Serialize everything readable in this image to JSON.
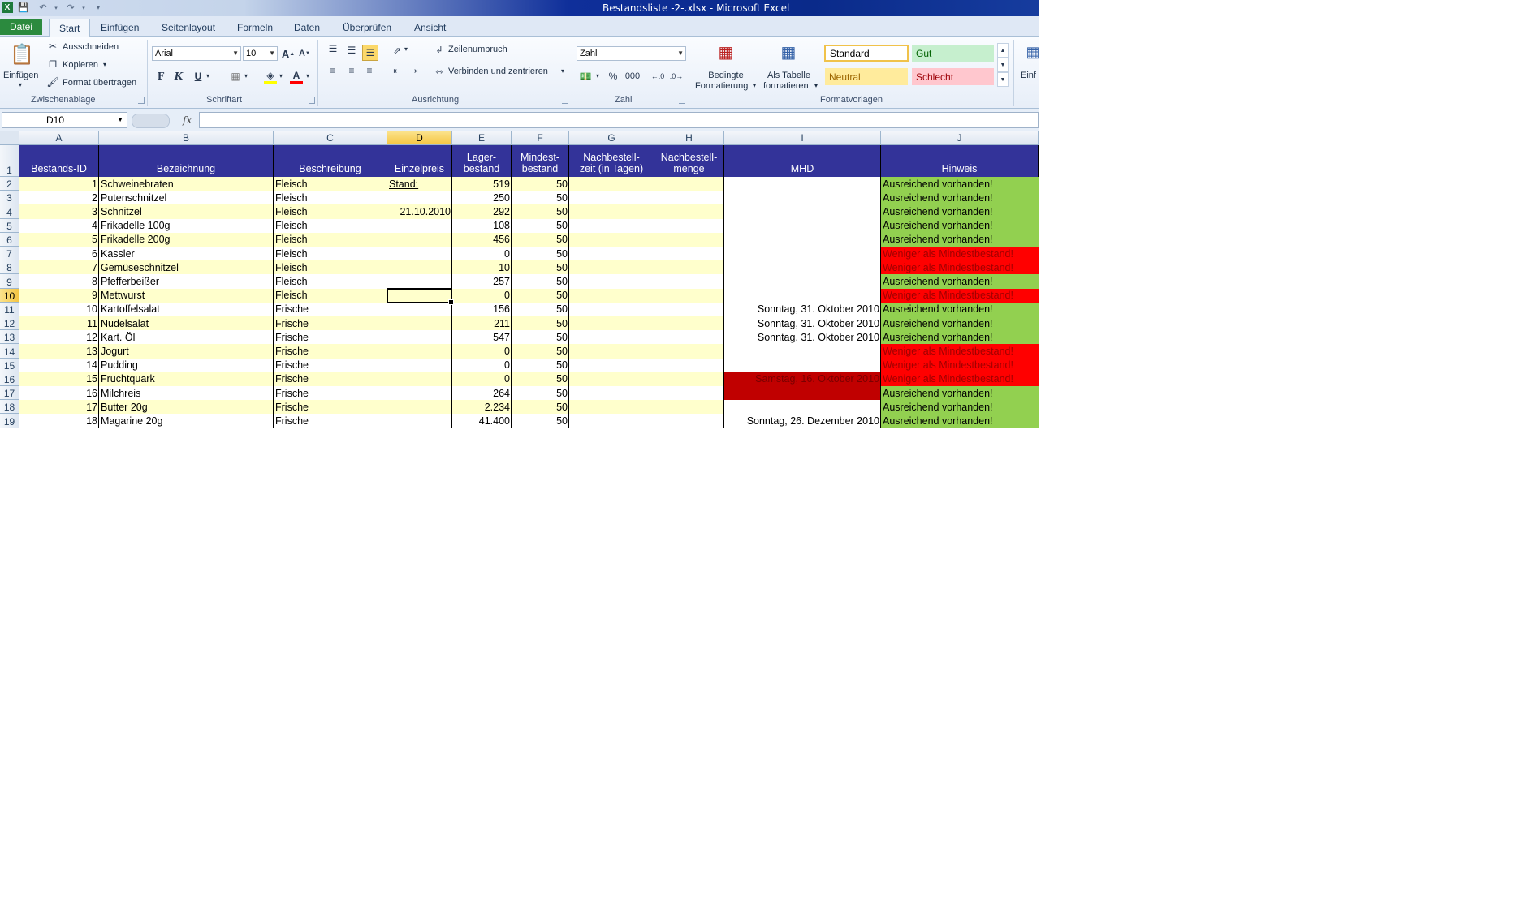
{
  "window": {
    "title": "Bestandsliste -2-.xlsx - Microsoft Excel",
    "app_icon": "excel-icon",
    "qat": [
      "save-icon",
      "undo-icon",
      "redo-icon",
      "customize-icon"
    ]
  },
  "tabs": {
    "file": "Datei",
    "items": [
      "Start",
      "Einfügen",
      "Seitenlayout",
      "Formeln",
      "Daten",
      "Überprüfen",
      "Ansicht"
    ],
    "active": "Start"
  },
  "ribbon": {
    "clipboard": {
      "paste": "Einfügen",
      "cut": "Ausschneiden",
      "copy": "Kopieren",
      "format_painter": "Format übertragen",
      "label": "Zwischenablage"
    },
    "font": {
      "name": "Arial",
      "size": "10",
      "bold": "F",
      "italic": "K",
      "underline": "U",
      "label": "Schriftart"
    },
    "alignment": {
      "wrap": "Zeilenumbruch",
      "merge": "Verbinden und zentrieren",
      "label": "Ausrichtung"
    },
    "number": {
      "format": "Zahl",
      "percent": "%",
      "thousands": "000",
      "label": "Zahl"
    },
    "styles": {
      "conditional": [
        "Bedingte",
        "Formatierung"
      ],
      "as_table": [
        "Als Tabelle",
        "formatieren"
      ],
      "standard": "Standard",
      "gut": "Gut",
      "neutral": "Neutral",
      "schlecht": "Schlecht",
      "label": "Formatvorlagen"
    },
    "cells": {
      "insert": "Einf"
    }
  },
  "formula_bar": {
    "name_box": "D10",
    "fx": "fx",
    "content": ""
  },
  "sheet": {
    "columns": [
      "A",
      "B",
      "C",
      "D",
      "E",
      "F",
      "G",
      "H",
      "I",
      "J"
    ],
    "selected_column": "D",
    "selected_row": "10",
    "headers": {
      "A": "Bestands-ID",
      "B": "Bezeichnung",
      "C": "Beschreibung",
      "D": "Einzelpreis",
      "E": [
        "Lager-",
        "bestand"
      ],
      "F": [
        "Mindest-",
        "bestand"
      ],
      "G": [
        "Nachbestell-",
        "zeit (in Tagen)"
      ],
      "H": [
        "Nachbestell-",
        "menge"
      ],
      "I": "MHD",
      "J": "Hinweis"
    },
    "rows": [
      {
        "n": "2",
        "id": "1",
        "name": "Schweinebraten",
        "desc": "Fleisch",
        "price": "Stand:",
        "stock": "519",
        "min": "50",
        "mhd": "",
        "hint": "Ausreichend vorhanden!",
        "status": "ok"
      },
      {
        "n": "3",
        "id": "2",
        "name": "Putenschnitzel",
        "desc": "Fleisch",
        "price": "",
        "stock": "250",
        "min": "50",
        "mhd": "",
        "hint": "Ausreichend vorhanden!",
        "status": "ok"
      },
      {
        "n": "4",
        "id": "3",
        "name": "Schnitzel",
        "desc": "Fleisch",
        "price": "21.10.2010",
        "stock": "292",
        "min": "50",
        "mhd": "",
        "hint": "Ausreichend vorhanden!",
        "status": "ok"
      },
      {
        "n": "5",
        "id": "4",
        "name": "Frikadelle 100g",
        "desc": "Fleisch",
        "price": "",
        "stock": "108",
        "min": "50",
        "mhd": "",
        "hint": "Ausreichend vorhanden!",
        "status": "ok"
      },
      {
        "n": "6",
        "id": "5",
        "name": "Frikadelle 200g",
        "desc": "Fleisch",
        "price": "",
        "stock": "456",
        "min": "50",
        "mhd": "",
        "hint": "Ausreichend vorhanden!",
        "status": "ok"
      },
      {
        "n": "7",
        "id": "6",
        "name": "Kassler",
        "desc": "Fleisch",
        "price": "",
        "stock": "0",
        "min": "50",
        "mhd": "",
        "hint": "Weniger als Mindestbestand!",
        "status": "low"
      },
      {
        "n": "8",
        "id": "7",
        "name": "Gemüseschnitzel",
        "desc": "Fleisch",
        "price": "",
        "stock": "10",
        "min": "50",
        "mhd": "",
        "hint": "Weniger als Mindestbestand!",
        "status": "low"
      },
      {
        "n": "9",
        "id": "8",
        "name": "Pfefferbeißer",
        "desc": "Fleisch",
        "price": "",
        "stock": "257",
        "min": "50",
        "mhd": "",
        "hint": "Ausreichend vorhanden!",
        "status": "ok"
      },
      {
        "n": "10",
        "id": "9",
        "name": "Mettwurst",
        "desc": "Fleisch",
        "price": "",
        "stock": "0",
        "min": "50",
        "mhd": "",
        "hint": "Weniger als Mindestbestand!",
        "status": "low"
      },
      {
        "n": "11",
        "id": "10",
        "name": "Kartoffelsalat",
        "desc": "Frische",
        "price": "",
        "stock": "156",
        "min": "50",
        "mhd": "Sonntag, 31. Oktober 2010",
        "hint": "Ausreichend vorhanden!",
        "status": "ok"
      },
      {
        "n": "12",
        "id": "11",
        "name": "Nudelsalat",
        "desc": "Frische",
        "price": "",
        "stock": "211",
        "min": "50",
        "mhd": "Sonntag, 31. Oktober 2010",
        "hint": "Ausreichend vorhanden!",
        "status": "ok"
      },
      {
        "n": "13",
        "id": "12",
        "name": "Kart. Öl",
        "desc": "Frische",
        "price": "",
        "stock": "547",
        "min": "50",
        "mhd": "Sonntag, 31. Oktober 2010",
        "hint": "Ausreichend vorhanden!",
        "status": "ok"
      },
      {
        "n": "14",
        "id": "13",
        "name": "Jogurt",
        "desc": "Frische",
        "price": "",
        "stock": "0",
        "min": "50",
        "mhd": "",
        "hint": "Weniger als Mindestbestand!",
        "status": "low"
      },
      {
        "n": "15",
        "id": "14",
        "name": "Pudding",
        "desc": "Frische",
        "price": "",
        "stock": "0",
        "min": "50",
        "mhd": "",
        "hint": "Weniger als Mindestbestand!",
        "status": "low"
      },
      {
        "n": "16",
        "id": "15",
        "name": "Fruchtquark",
        "desc": "Frische",
        "price": "",
        "stock": "0",
        "min": "50",
        "mhd": "Samstag, 16. Oktober 2010",
        "hint": "Weniger als Mindestbestand!",
        "status": "low",
        "mhd_expired": true
      },
      {
        "n": "17",
        "id": "16",
        "name": "Milchreis",
        "desc": "Frische",
        "price": "",
        "stock": "264",
        "min": "50",
        "mhd": "",
        "hint": "Ausreichend vorhanden!",
        "status": "ok",
        "mhd_expired": true
      },
      {
        "n": "18",
        "id": "17",
        "name": "Butter 20g",
        "desc": "Frische",
        "price": "",
        "stock": "2.234",
        "min": "50",
        "mhd": "",
        "hint": "Ausreichend vorhanden!",
        "status": "ok"
      },
      {
        "n": "19",
        "id": "18",
        "name": "Magarine 20g",
        "desc": "Frische",
        "price": "",
        "stock": "41.400",
        "min": "50",
        "mhd": "Sonntag, 26. Dezember 2010",
        "hint": "Ausreichend vorhanden!",
        "status": "ok"
      }
    ]
  },
  "colors": {
    "header_bg": "#333399",
    "row_yellow": "#ffffcc",
    "ok": "#92d050",
    "low": "#ff0000",
    "expired": "#c00000",
    "style_gut": "#c6efce",
    "style_neutral": "#ffeb9c",
    "style_schlecht": "#ffc7ce"
  }
}
